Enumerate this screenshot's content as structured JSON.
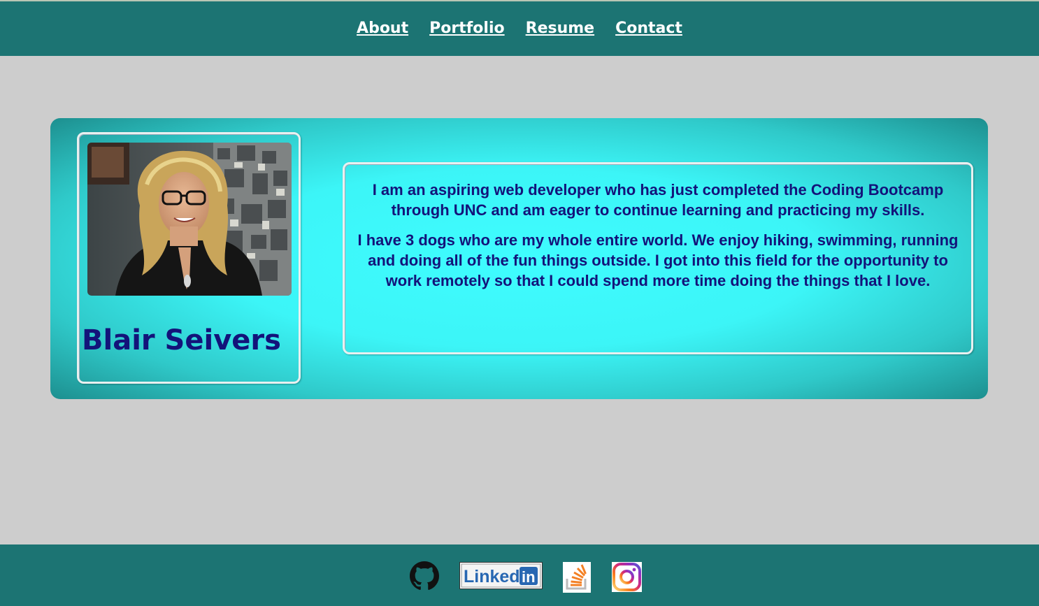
{
  "nav": {
    "items": [
      {
        "label": "About"
      },
      {
        "label": "Portfolio"
      },
      {
        "label": "Resume"
      },
      {
        "label": "Contact"
      }
    ]
  },
  "profile": {
    "name": "Blair Seivers",
    "photo_alt": "profile photo"
  },
  "bio": {
    "paragraphs": [
      "I am an aspiring web developer who has just completed the Coding Bootcamp through UNC and am eager to continue learning and practicing my skills.",
      "I have 3 dogs who are my whole entire world. We enjoy hiking, swimming, running and doing all of the fun things outside. I got into this field for the opportunity to work remotely so that I could spend more time doing the things that I love."
    ]
  },
  "footer": {
    "social": [
      {
        "icon": "github-icon"
      },
      {
        "icon": "linkedin-icon",
        "logo_text": "LinkedIn"
      },
      {
        "icon": "stackoverflow-icon"
      },
      {
        "icon": "instagram-icon"
      }
    ]
  },
  "colors": {
    "header_bg": "#1c7473",
    "page_bg": "#cdcdcd",
    "hero_center": "#3ffcff",
    "text_navy": "#13137a"
  }
}
